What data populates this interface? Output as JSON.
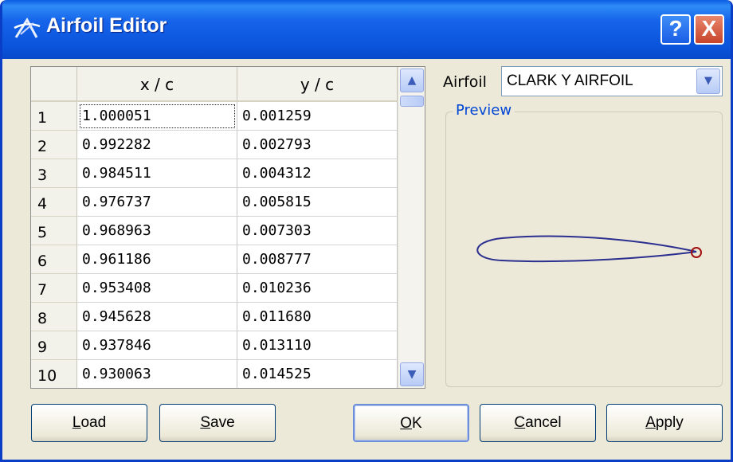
{
  "window": {
    "title": "Airfoil Editor"
  },
  "titlebar_buttons": {
    "help": "?",
    "close": "X"
  },
  "table": {
    "columns": [
      "x / c",
      "y / c"
    ],
    "rows": [
      {
        "num": "1",
        "x": "1.000051",
        "y": "0.001259"
      },
      {
        "num": "2",
        "x": "0.992282",
        "y": "0.002793"
      },
      {
        "num": "3",
        "x": "0.984511",
        "y": "0.004312"
      },
      {
        "num": "4",
        "x": "0.976737",
        "y": "0.005815"
      },
      {
        "num": "5",
        "x": "0.968963",
        "y": "0.007303"
      },
      {
        "num": "6",
        "x": "0.961186",
        "y": "0.008777"
      },
      {
        "num": "7",
        "x": "0.953408",
        "y": "0.010236"
      },
      {
        "num": "8",
        "x": "0.945628",
        "y": "0.011680"
      },
      {
        "num": "9",
        "x": "0.937846",
        "y": "0.013110"
      },
      {
        "num": "10",
        "x": "0.930063",
        "y": "0.014525"
      }
    ],
    "selected_cell": "row 1, x / c"
  },
  "airfoil": {
    "label": "Airfoil",
    "selected": "CLARK Y AIRFOIL"
  },
  "preview": {
    "title": "Preview",
    "stroke_color": "#2b2f8f",
    "marker_color": "#a01010"
  },
  "buttons": {
    "load": {
      "mnemonic": "L",
      "rest": "oad"
    },
    "save": {
      "mnemonic": "S",
      "rest": "ave"
    },
    "ok": {
      "mnemonic": "O",
      "rest": "K"
    },
    "cancel": {
      "mnemonic": "C",
      "rest": "ancel"
    },
    "apply": {
      "mnemonic": "A",
      "rest": "pply"
    }
  }
}
